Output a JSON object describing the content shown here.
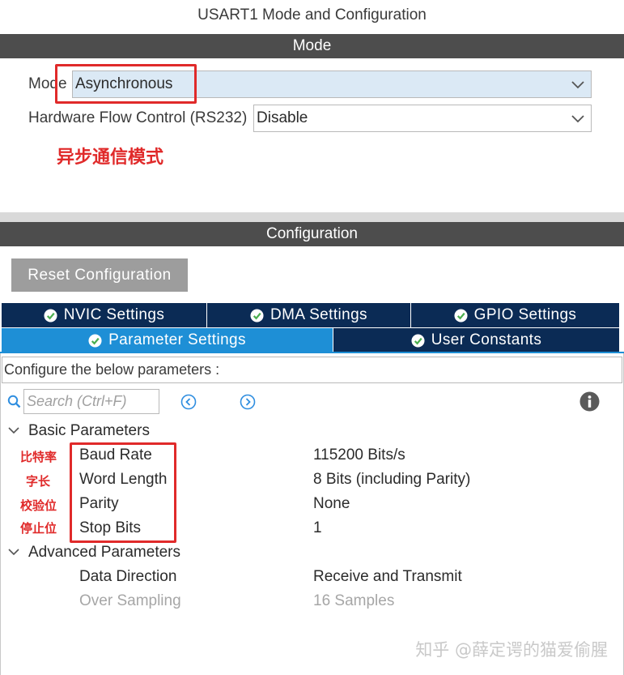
{
  "window": {
    "title": "USART1 Mode and Configuration"
  },
  "mode_section": {
    "header": "Mode",
    "mode_label": "Mode",
    "mode_value": "Asynchronous",
    "flow_label": "Hardware Flow Control (RS232)",
    "flow_value": "Disable",
    "annotation": "异步通信模式"
  },
  "config_section": {
    "header": "Configuration",
    "reset_button": "Reset Configuration",
    "tabs_row1": [
      {
        "label": "NVIC Settings"
      },
      {
        "label": "DMA Settings"
      },
      {
        "label": "GPIO Settings"
      }
    ],
    "tabs_row2": [
      {
        "label": "Parameter Settings",
        "active": true
      },
      {
        "label": "User Constants"
      }
    ],
    "hint": "Configure the below parameters :",
    "search_placeholder": "Search (Ctrl+F)"
  },
  "parameters": {
    "basic_group": "Basic Parameters",
    "basic": [
      {
        "name": "Baud Rate",
        "value": "115200 Bits/s",
        "annotation": "比特率"
      },
      {
        "name": "Word Length",
        "value": "8 Bits (including Parity)",
        "annotation": "字长"
      },
      {
        "name": "Parity",
        "value": "None",
        "annotation": "校验位"
      },
      {
        "name": "Stop Bits",
        "value": "1",
        "annotation": "停止位"
      }
    ],
    "advanced_group": "Advanced Parameters",
    "advanced": [
      {
        "name": "Data Direction",
        "value": "Receive and Transmit",
        "disabled": false
      },
      {
        "name": "Over Sampling",
        "value": "16 Samples",
        "disabled": true
      }
    ]
  },
  "watermark": "知乎 @薛定谔的猫爱偷腥",
  "colors": {
    "header_gray": "#4d4d4d",
    "tab_dark": "#0b2b55",
    "tab_active": "#1e8fd6",
    "annotation_red": "#e02a2a",
    "icon_blue": "#2f8ee0"
  },
  "icons": {
    "tab_check": "check-circle-icon",
    "search": "search-icon",
    "prev": "previous-circle-icon",
    "next": "next-circle-icon",
    "info": "info-icon"
  }
}
